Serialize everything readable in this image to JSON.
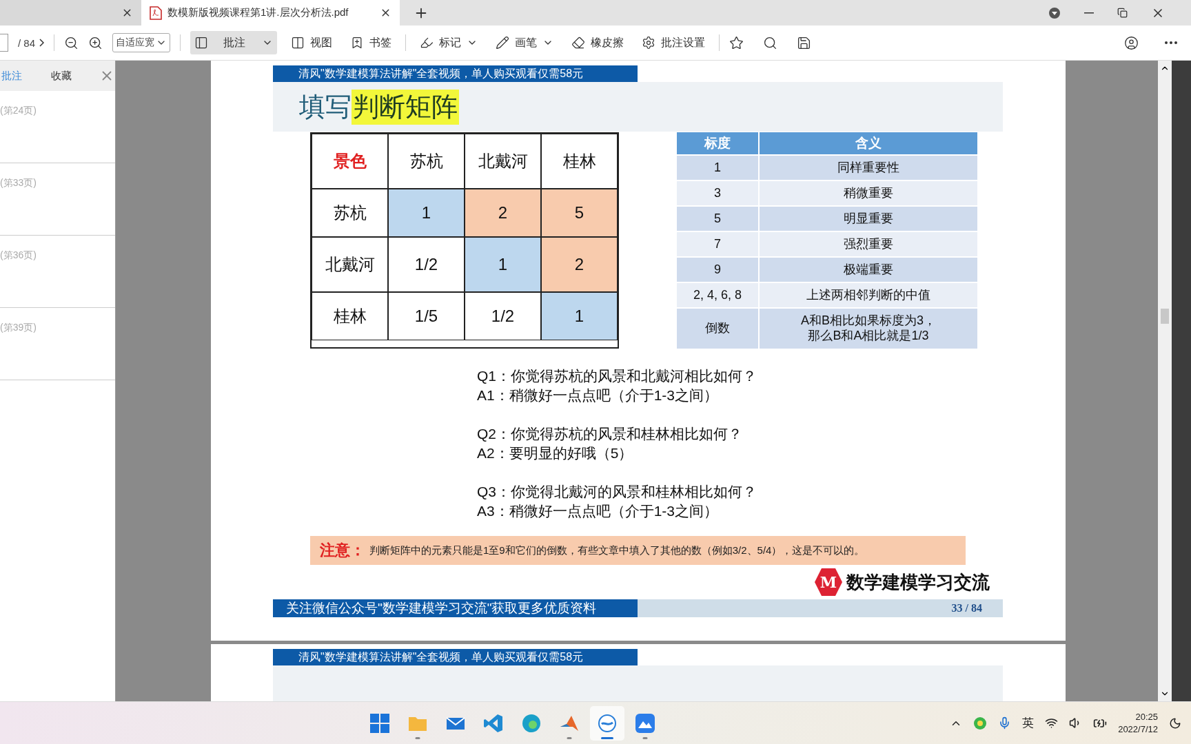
{
  "tabs": [
    {
      "selected": false
    },
    {
      "title": "数模新版视频课程第1讲.层次分析法.pdf",
      "selected": true
    }
  ],
  "toolbar": {
    "page_total": "/ 84",
    "zoom_select": "自适应宽",
    "tools": [
      {
        "label": "批注",
        "selected": true,
        "dropdown": true
      },
      {
        "label": "视图",
        "selected": false,
        "dropdown": false
      },
      {
        "label": "书签",
        "selected": false,
        "dropdown": false
      },
      {
        "label": "标记",
        "selected": false,
        "dropdown": true
      },
      {
        "label": "画笔",
        "selected": false,
        "dropdown": true
      },
      {
        "label": "橡皮擦",
        "selected": false,
        "dropdown": false
      },
      {
        "label": "批注设置",
        "selected": false,
        "dropdown": false
      }
    ]
  },
  "sidebar": {
    "tabs": [
      {
        "label": "批注",
        "selected": true
      },
      {
        "label": "收藏",
        "selected": false
      }
    ],
    "items": [
      "(第24页)",
      "(第33页)",
      "(第36页)",
      "(第39页)"
    ]
  },
  "slide": {
    "banner": "清风\"数学建模算法讲解\"全套视频，单人购买观看仅需58元",
    "title": "填写",
    "title_highlight": "判断矩阵",
    "matrix": [
      [
        {
          "text": "景色",
          "kind": "corner"
        },
        {
          "text": "苏杭"
        },
        {
          "text": "北戴河"
        },
        {
          "text": "桂林"
        }
      ],
      [
        {
          "text": "苏杭"
        },
        {
          "text": "1",
          "color": "#bdd7ee"
        },
        {
          "text": "2",
          "color": "#f8cbad"
        },
        {
          "text": "5",
          "color": "#f8cbad"
        }
      ],
      [
        {
          "text": "北戴河"
        },
        {
          "text": "1/2"
        },
        {
          "text": "1",
          "color": "#bdd7ee"
        },
        {
          "text": "2",
          "color": "#f8cbad"
        }
      ],
      [
        {
          "text": "桂林"
        },
        {
          "text": "1/5"
        },
        {
          "text": "1/2"
        },
        {
          "text": "1",
          "color": "#bdd7ee"
        }
      ]
    ],
    "scale_table": {
      "columns": [
        "标度",
        "含义"
      ],
      "rows": [
        [
          "1",
          "同样重要性"
        ],
        [
          "3",
          "稍微重要"
        ],
        [
          "5",
          "明显重要"
        ],
        [
          "7",
          "强烈重要"
        ],
        [
          "9",
          "极端重要"
        ],
        [
          "2, 4, 6, 8",
          "上述两相邻判断的中值"
        ],
        [
          "倒数",
          "A和B相比如果标度为3，那么B和A相比就是1/3"
        ]
      ]
    },
    "qa": [
      {
        "q": "Q1：你觉得苏杭的风景和北戴河相比如何？",
        "a": "A1：稍微好一点点吧（介于1-3之间）"
      },
      {
        "q": "Q2：你觉得苏杭的风景和桂林相比如何？",
        "a": "A2：要明显的好哦（5）"
      },
      {
        "q": "Q3：你觉得北戴河的风景和桂林相比如何？",
        "a": "A3：稍微好一点点吧（介于1-3之间）"
      }
    ],
    "notice": {
      "label": "注意：",
      "text": "判断矩阵中的元素只能是1至9和它们的倒数，有些文章中填入了其他的数（例如3/2、5/4），这是不可以的。"
    },
    "logo": {
      "mark": "M",
      "text": "数学建模学习交流"
    },
    "footer": {
      "text": "关注微信公众号\"数学建模学习交流\"获取更多优质资料",
      "page": "33 / 84"
    }
  },
  "next_slide": {
    "banner": "清风\"数学建模算法讲解\"全套视频，单人购买观看仅需58元"
  },
  "taskbar": {
    "apps": [
      {
        "running": false,
        "active": false
      },
      {
        "running": true,
        "active": false
      },
      {
        "running": false,
        "active": false
      },
      {
        "running": false,
        "active": false
      },
      {
        "running": false,
        "active": false
      },
      {
        "running": true,
        "active": false
      },
      {
        "running": true,
        "active": true
      },
      {
        "running": true,
        "active": false
      }
    ],
    "ime": "英",
    "time": "20:25",
    "date": "2022/7/12"
  }
}
